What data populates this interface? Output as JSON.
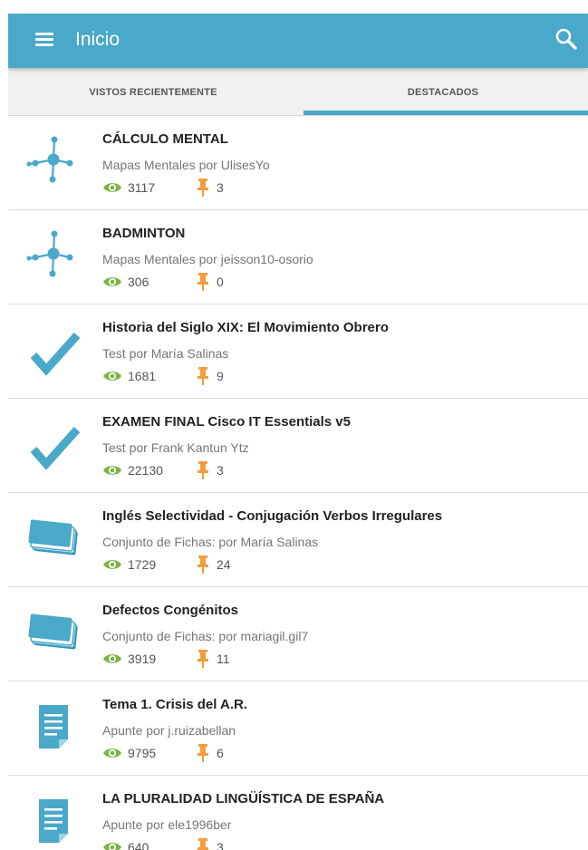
{
  "header": {
    "title": "Inicio"
  },
  "tabs": [
    {
      "label": "VISTOS RECIENTEMENTE",
      "active": false
    },
    {
      "label": "DESTACADOS",
      "active": true
    }
  ],
  "colors": {
    "primary": "#4aa8c9",
    "eye": "#7cb342",
    "pin": "#f39c3d",
    "icon_blue": "#4aa8c9"
  },
  "items": [
    {
      "icon": "mind-map-icon",
      "title": "CÁLCULO  MENTAL",
      "subtitle": "Mapas Mentales por UlisesYo",
      "views": "3117",
      "pins": "3"
    },
    {
      "icon": "mind-map-icon",
      "title": "BADMINTON",
      "subtitle": "Mapas Mentales por jeisson10-osorio",
      "views": "306",
      "pins": "0"
    },
    {
      "icon": "checkmark-icon",
      "title": "Historia del Siglo XIX: El Movimiento Obrero",
      "subtitle": "Test por María Salinas",
      "views": "1681",
      "pins": "9"
    },
    {
      "icon": "checkmark-icon",
      "title": "EXAMEN FINAL Cisco IT Essentials v5",
      "subtitle": "Test por Frank Kantun Ytz",
      "views": "22130",
      "pins": "3"
    },
    {
      "icon": "flashcards-icon",
      "title": "Inglés Selectividad - Conjugación Verbos Irregulares",
      "subtitle": "Conjunto de Fichas: por María Salinas",
      "views": "1729",
      "pins": "24"
    },
    {
      "icon": "flashcards-icon",
      "title": "Defectos Congénitos",
      "subtitle": "Conjunto de Fichas: por mariagil.gil7",
      "views": "3919",
      "pins": "11"
    },
    {
      "icon": "note-icon",
      "title": "Tema 1. Crisis del A.R.",
      "subtitle": "Apunte por j.ruizabellan",
      "views": "9795",
      "pins": "6"
    },
    {
      "icon": "note-icon",
      "title": "LA PLURALIDAD LINGÜÍSTICA DE ESPAÑA",
      "subtitle": "Apunte por ele1996ber",
      "views": "640",
      "pins": "3"
    }
  ]
}
